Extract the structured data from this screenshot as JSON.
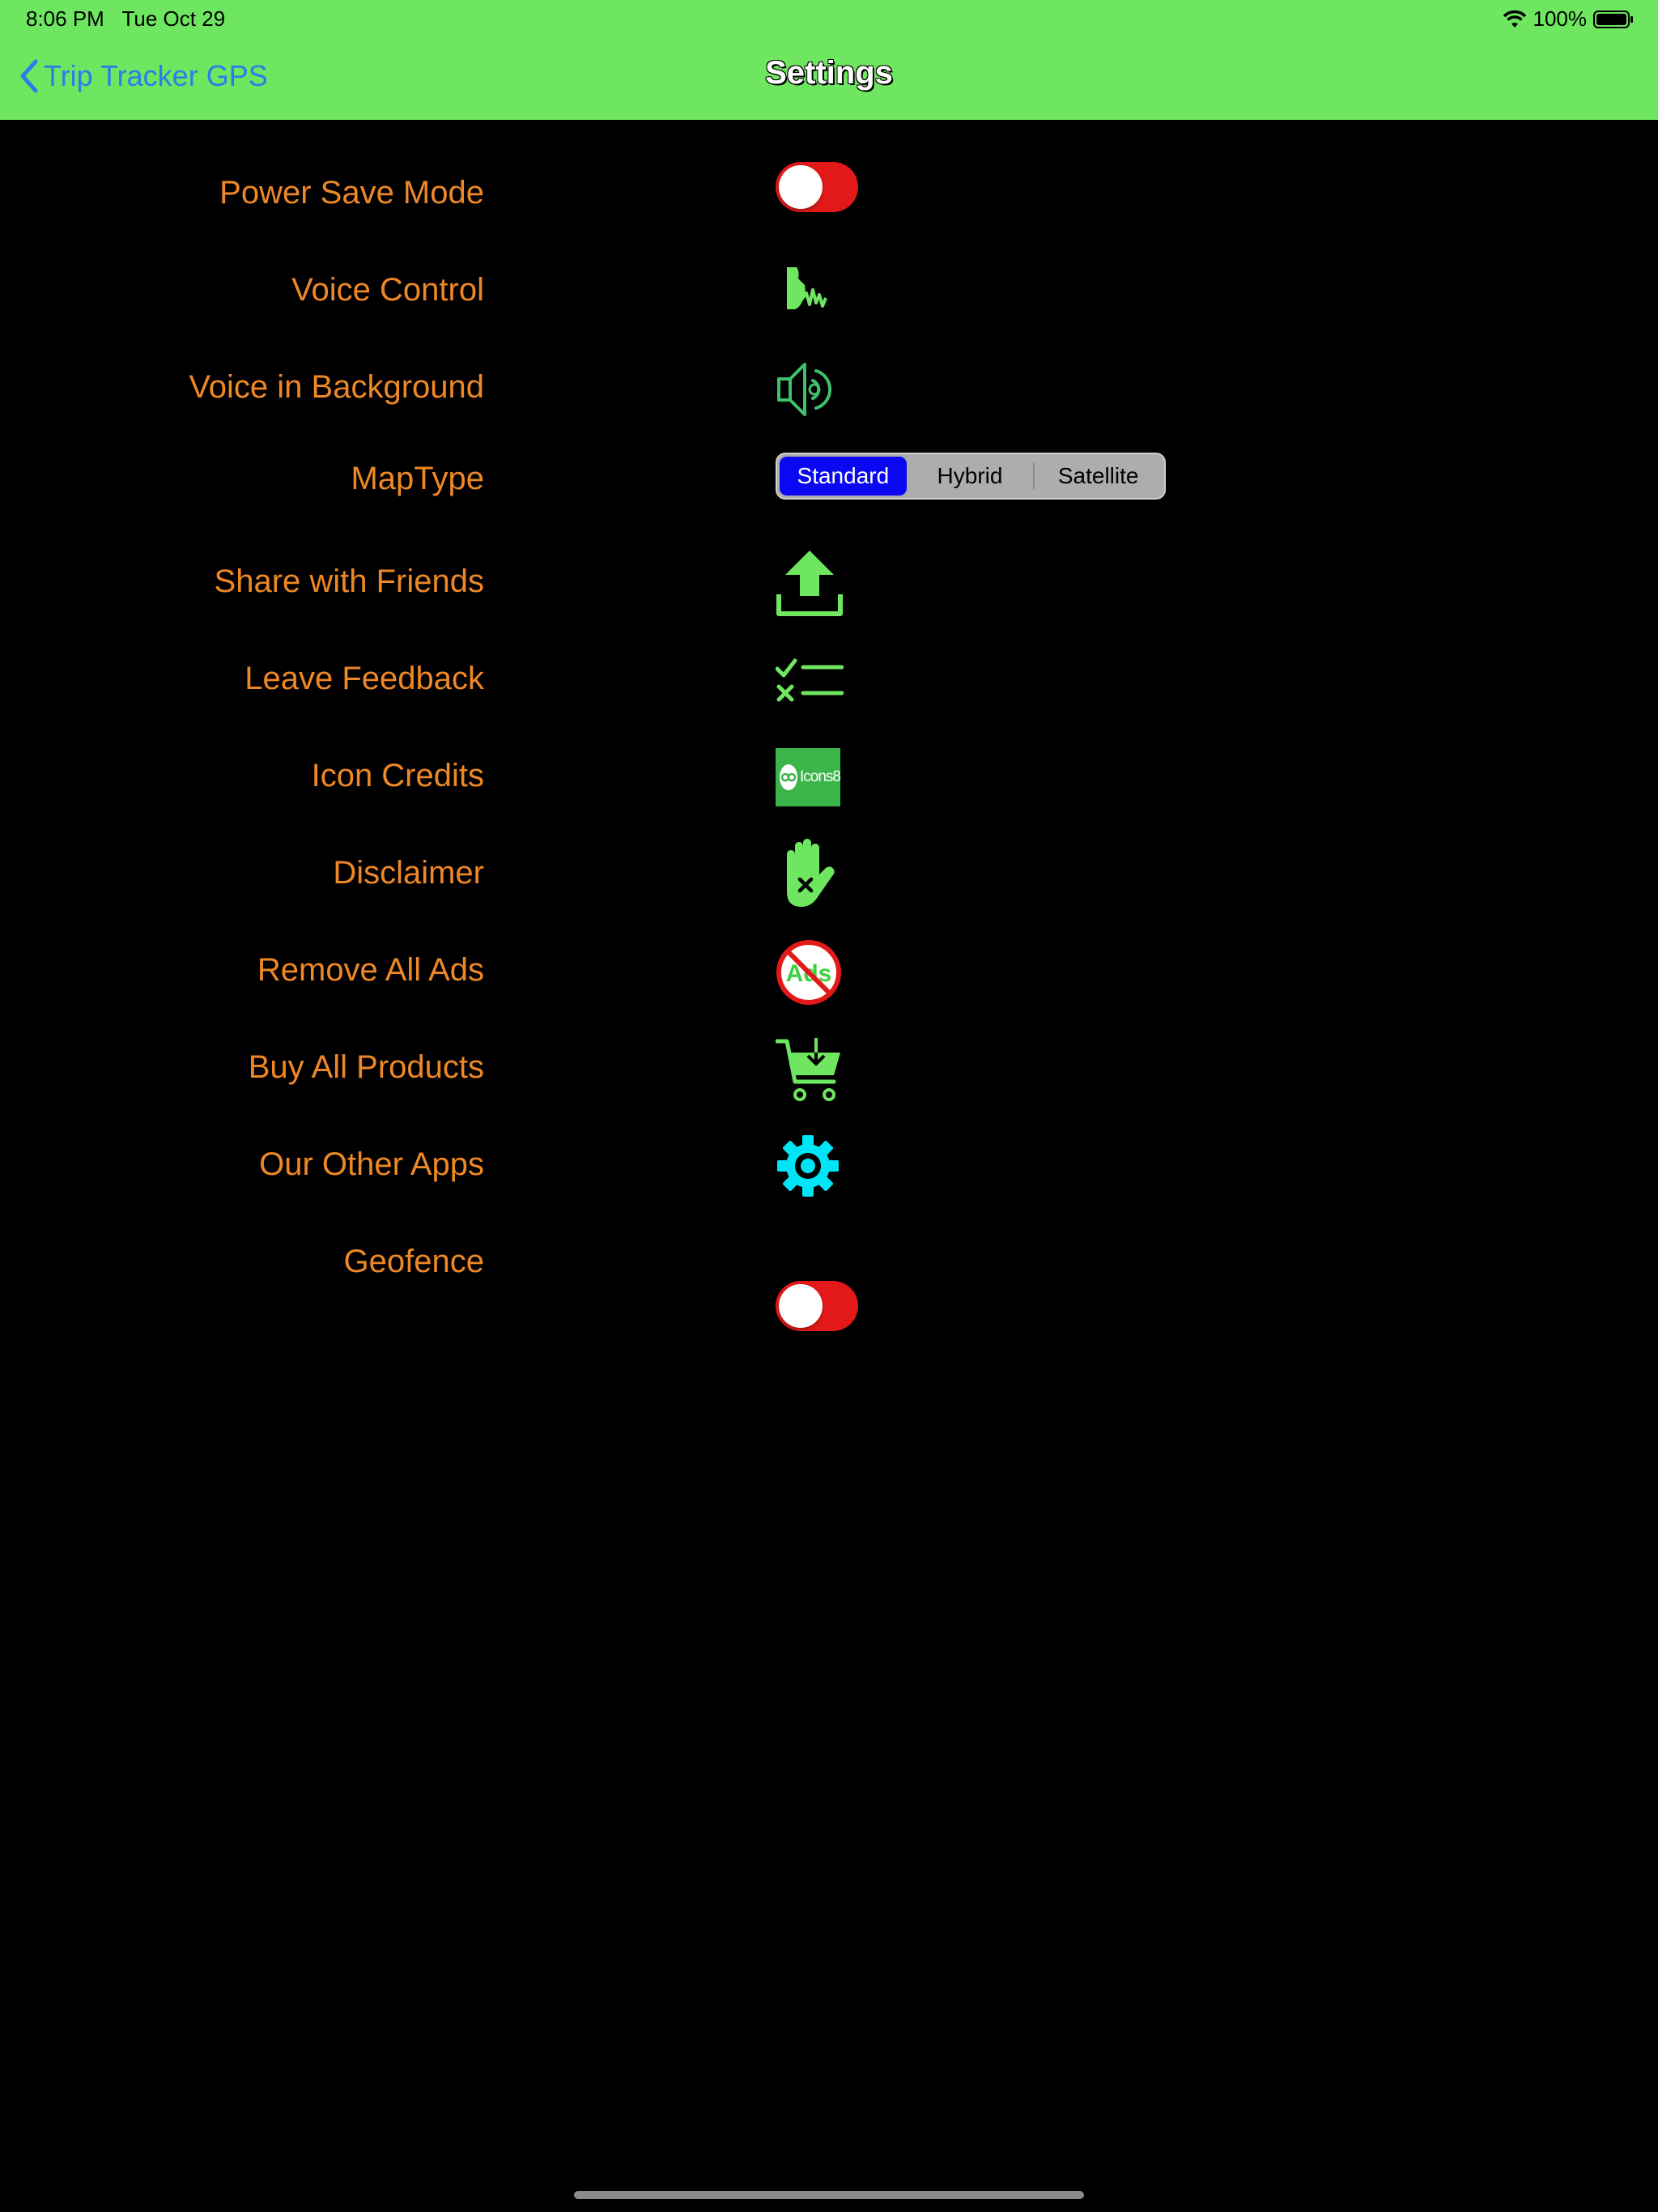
{
  "status": {
    "time": "8:06 PM",
    "date": "Tue Oct 29",
    "battery": "100%"
  },
  "nav": {
    "back_label": "Trip Tracker GPS",
    "title": "Settings"
  },
  "rows": [
    {
      "label": "Power Save Mode",
      "control": "toggle",
      "on": false
    },
    {
      "label": "Voice Control",
      "control": "voice-wave-icon"
    },
    {
      "label": "Voice in Background",
      "control": "speaker-icon"
    },
    {
      "label": "MapType",
      "control": "segmented"
    },
    {
      "label": "Share with Friends",
      "control": "upload-icon"
    },
    {
      "label": "Leave Feedback",
      "control": "checklist-icon"
    },
    {
      "label": "Icon Credits",
      "control": "icons8-logo"
    },
    {
      "label": "Disclaimer",
      "control": "hand-icon"
    },
    {
      "label": "Remove All Ads",
      "control": "no-ads-icon"
    },
    {
      "label": "Buy All Products",
      "control": "cart-icon"
    },
    {
      "label": "Our Other Apps",
      "control": "gear-icon"
    },
    {
      "label": "Geofence",
      "control": "toggle",
      "on": false
    }
  ],
  "map_type": {
    "options": [
      "Standard",
      "Hybrid",
      "Satellite"
    ],
    "selected": "Standard"
  },
  "ads_icon_text": "Ads",
  "icons8_text": "Icons8",
  "colors": {
    "nav_bg": "#6ee660",
    "label": "#ee8826",
    "icon_green": "#6ee660",
    "toggle_off": "#e31919",
    "segment_active": "#0a07f2",
    "gear": "#00e5f5"
  }
}
